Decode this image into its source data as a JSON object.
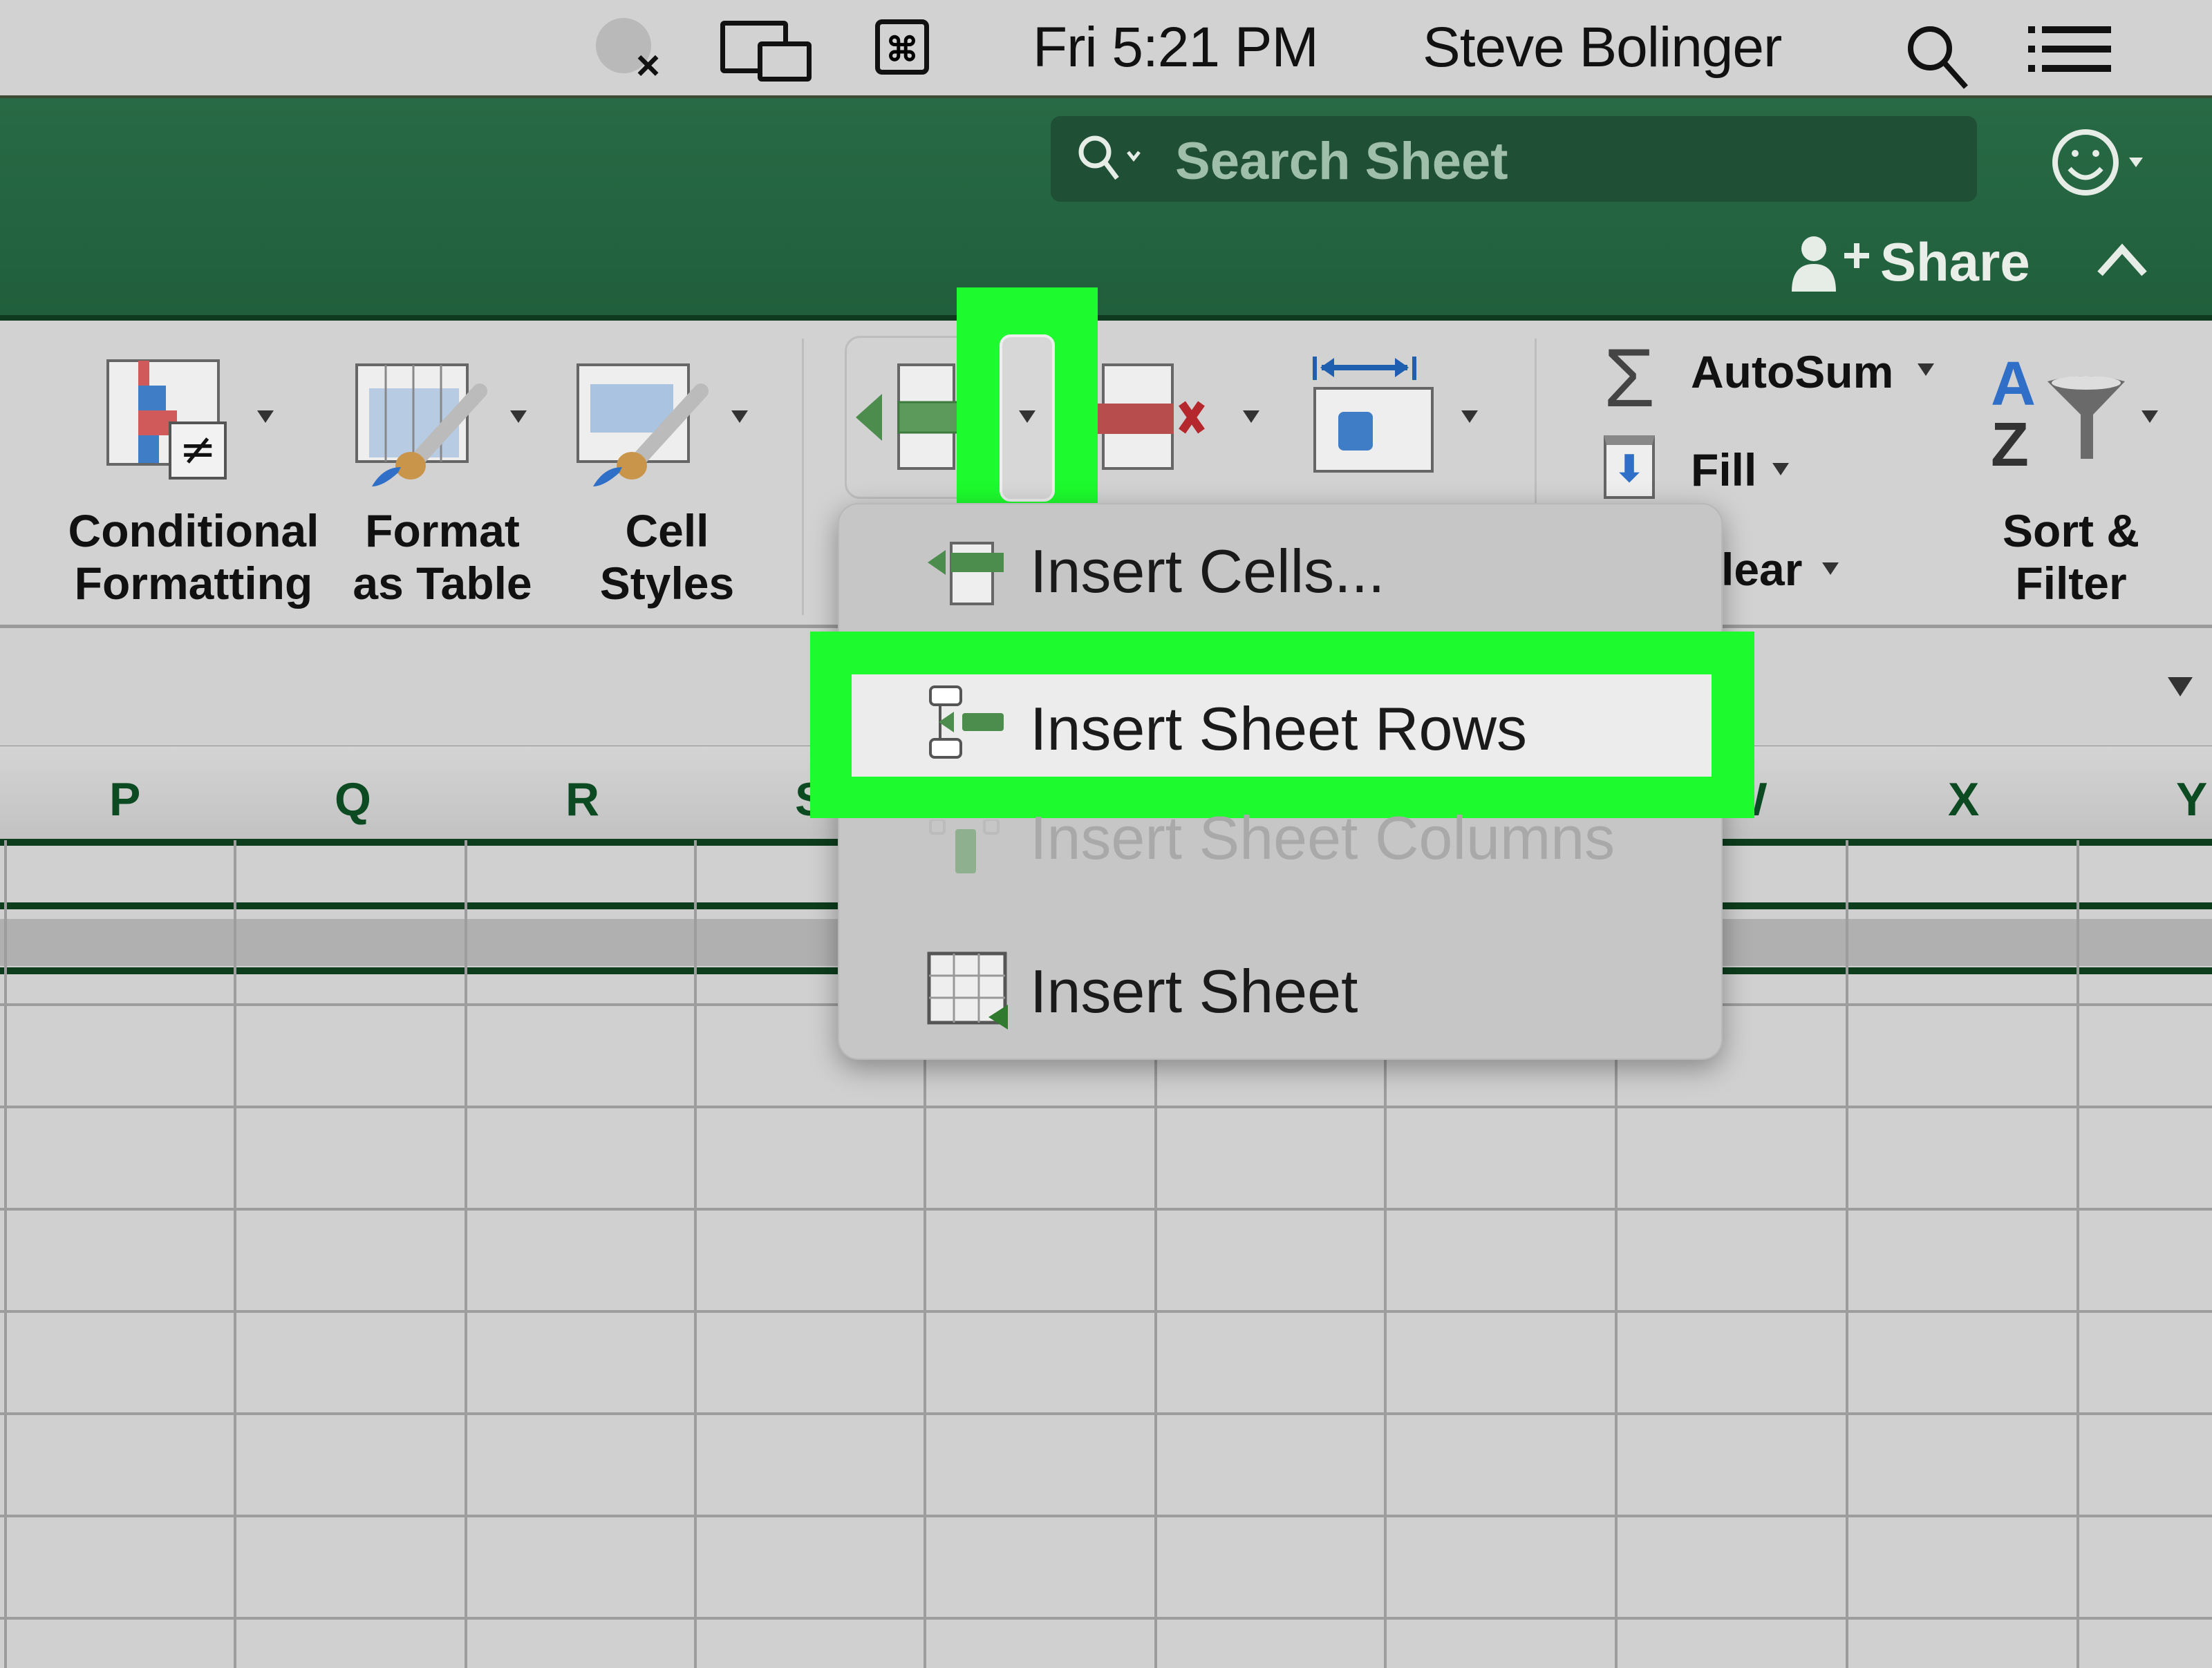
{
  "menubar": {
    "clock": "Fri 5:21 PM",
    "user": "Steve Bolinger",
    "icons": [
      "bear-disabled-icon",
      "screen-mirroring-icon",
      "command-app-icon",
      "spotlight-search-icon",
      "notification-list-icon"
    ]
  },
  "titlebar": {
    "search_placeholder": "Search Sheet",
    "share_label": "Share",
    "colors": {
      "accent_green": "#217346",
      "highlight_green": "#1dfa2d"
    }
  },
  "ribbon": {
    "styles_group": [
      {
        "line1": "Conditional",
        "line2": "Formatting",
        "icon": "conditional-formatting-icon"
      },
      {
        "line1": "Format",
        "line2": "as Table",
        "icon": "format-as-table-icon"
      },
      {
        "line1": "Cell",
        "line2": "Styles",
        "icon": "cell-styles-icon"
      }
    ],
    "cells_group": {
      "insert_icon": "insert-cells-icon",
      "delete_icon": "delete-cells-icon",
      "format_icon": "format-cells-icon"
    },
    "editing_group": {
      "autosum": "AutoSum",
      "fill": "Fill",
      "clear": "lear",
      "sort_filter_line1": "Sort &",
      "sort_filter_line2": "Filter"
    }
  },
  "columns": [
    "P",
    "Q",
    "R",
    "S",
    "W",
    "X",
    "Y"
  ],
  "insert_menu": {
    "items": [
      {
        "label": "Insert Cells...",
        "enabled": true,
        "highlighted": false
      },
      {
        "label": "Insert Sheet Rows",
        "enabled": true,
        "highlighted": true
      },
      {
        "label": "Insert Sheet Columns",
        "enabled": false,
        "highlighted": false
      },
      {
        "label": "Insert Sheet",
        "enabled": true,
        "highlighted": false
      }
    ]
  }
}
